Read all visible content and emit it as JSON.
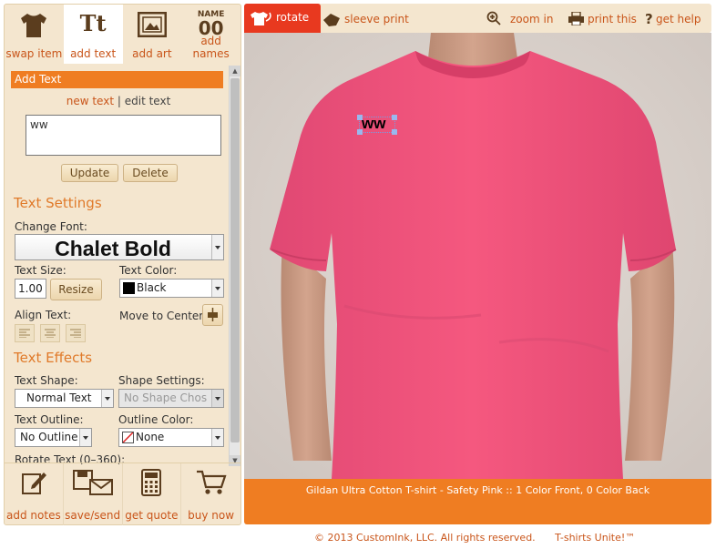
{
  "tabs_top": [
    {
      "label": "swap item",
      "icon": "tshirt-icon"
    },
    {
      "label": "add text",
      "icon": "text-tt-icon"
    },
    {
      "label": "add art",
      "icon": "picture-frame-icon"
    },
    {
      "label": "add names",
      "icon": "name-number-icon",
      "icon_text_top": "NAME",
      "icon_text_bottom": "00"
    }
  ],
  "tabs_bottom": [
    {
      "label": "add notes",
      "icon": "notes-pencil-icon"
    },
    {
      "label": "save/send",
      "icon": "save-send-icon"
    },
    {
      "label": "get quote",
      "icon": "calculator-icon"
    },
    {
      "label": "buy now",
      "icon": "cart-icon"
    }
  ],
  "panel": {
    "header": "Add Text",
    "mode_new": "new text",
    "mode_sep": "|",
    "mode_edit": "edit text",
    "text_value": "ww",
    "update_label": "Update",
    "delete_label": "Delete",
    "text_settings_title": "Text Settings",
    "change_font_label": "Change Font:",
    "font_value": "Chalet Bold",
    "text_size_label": "Text Size:",
    "text_size_value": "1.00",
    "resize_label": "Resize",
    "text_color_label": "Text Color:",
    "text_color_value": "Black",
    "text_color_hex": "#000000",
    "align_text_label": "Align Text:",
    "move_center_label": "Move to Center",
    "text_effects_title": "Text Effects",
    "text_shape_label": "Text Shape:",
    "text_shape_value": "Normal Text",
    "shape_settings_label": "Shape Settings:",
    "shape_settings_value": "No Shape Chos",
    "text_outline_label": "Text Outline:",
    "text_outline_value": "No Outline",
    "outline_color_label": "Outline Color:",
    "outline_color_value": "None",
    "rotate_label": "Rotate Text (0–360):"
  },
  "toolbar": {
    "rotate": "rotate",
    "sleeve_print": "sleeve print",
    "zoom_in": "zoom in",
    "print_this": "print this",
    "get_help": "get help"
  },
  "stage": {
    "design_text": "ww",
    "shirt_color": "#f0527f",
    "caption": "Gildan Ultra Cotton T-shirt - Safety Pink :: 1 Color Front, 0 Color Back"
  },
  "footer": {
    "copyright": "© 2013 CustomInk, LLC. All rights reserved.",
    "tagline": "T-shirts Unite!™"
  },
  "colors": {
    "accent": "#ef7d22",
    "rotate_red": "#e8391f",
    "link": "#c9551a",
    "panel_bg": "#f4e6cf"
  }
}
